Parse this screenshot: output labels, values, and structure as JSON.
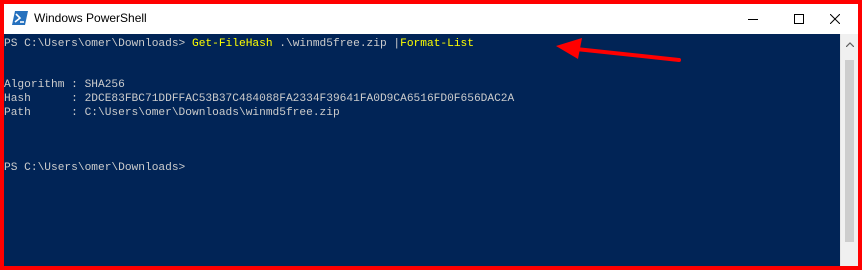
{
  "window": {
    "title": "Windows PowerShell",
    "icon": "powershell-icon",
    "controls": [
      "minimize-icon",
      "maximize-icon",
      "close-icon"
    ]
  },
  "console": {
    "lines": [
      {
        "prompt": "PS C:\\Users\\omer\\Downloads> ",
        "command": "Get-FileHash",
        "args": " .\\winmd5free.zip |",
        "pipe_command": "Format-List"
      },
      {
        "text": "Algorithm : SHA256"
      },
      {
        "text": "Hash      : 2DCE83FBC71DDFFAC53B37C484088FA2334F39641FA0D9CA6516FD0F656DAC2A"
      },
      {
        "text": "Path      : C:\\Users\\omer\\Downloads\\winmd5free.zip"
      },
      {
        "prompt": "PS C:\\Users\\omer\\Downloads>"
      }
    ]
  },
  "colors": {
    "console_bg": "#012456",
    "console_text": "#cccccc",
    "command_text": "#ffff00",
    "annotation": "#ff0000"
  }
}
